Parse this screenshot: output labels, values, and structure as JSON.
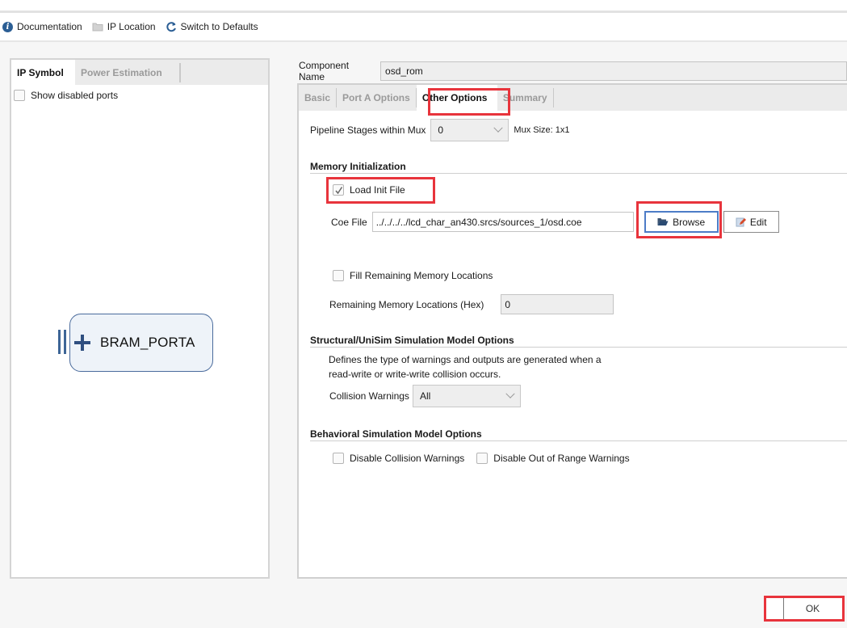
{
  "toolbar": {
    "documentation": "Documentation",
    "ip_location": "IP Location",
    "switch_defaults": "Switch to Defaults"
  },
  "left_panel": {
    "tabs": [
      {
        "label": "IP Symbol",
        "active": true
      },
      {
        "label": "Power Estimation",
        "active": false
      }
    ],
    "show_disabled_ports": {
      "label": "Show disabled ports",
      "checked": false
    },
    "symbol": {
      "port_label": "BRAM_PORTA"
    }
  },
  "component": {
    "label": "Component Name",
    "value": "osd_rom"
  },
  "right_panel": {
    "tabs": [
      {
        "label": "Basic",
        "active": false
      },
      {
        "label": "Port A Options",
        "active": false
      },
      {
        "label": "Other Options",
        "active": true
      },
      {
        "label": "Summary",
        "active": false
      }
    ],
    "pipeline": {
      "label": "Pipeline Stages within Mux",
      "value": "0",
      "mux_size": "Mux Size: 1x1"
    },
    "memory_init": {
      "title": "Memory Initialization",
      "load_init": {
        "label": "Load Init File",
        "checked": true
      },
      "coe_label": "Coe File",
      "coe_value": "../../../../lcd_char_an430.srcs/sources_1/osd.coe",
      "browse": "Browse",
      "edit": "Edit",
      "fill_remaining": {
        "label": "Fill Remaining Memory Locations",
        "checked": false
      },
      "remaining_label": "Remaining Memory Locations (Hex)",
      "remaining_value": "0"
    },
    "structural": {
      "title": "Structural/UniSim Simulation Model Options",
      "desc_line1": "Defines the type of warnings and outputs are generated when a",
      "desc_line2": "read-write or write-write collision occurs.",
      "collision_label": "Collision Warnings",
      "collision_value": "All"
    },
    "behavioral": {
      "title": "Behavioral Simulation Model Options",
      "disable_collision": {
        "label": "Disable Collision Warnings",
        "checked": false
      },
      "disable_out_of_range": {
        "label": "Disable Out of Range Warnings",
        "checked": false
      }
    }
  },
  "footer": {
    "ok": "OK"
  },
  "colors": {
    "highlight": "#e8343c",
    "focus": "#4d7cc7",
    "info": "#2b5e94"
  }
}
